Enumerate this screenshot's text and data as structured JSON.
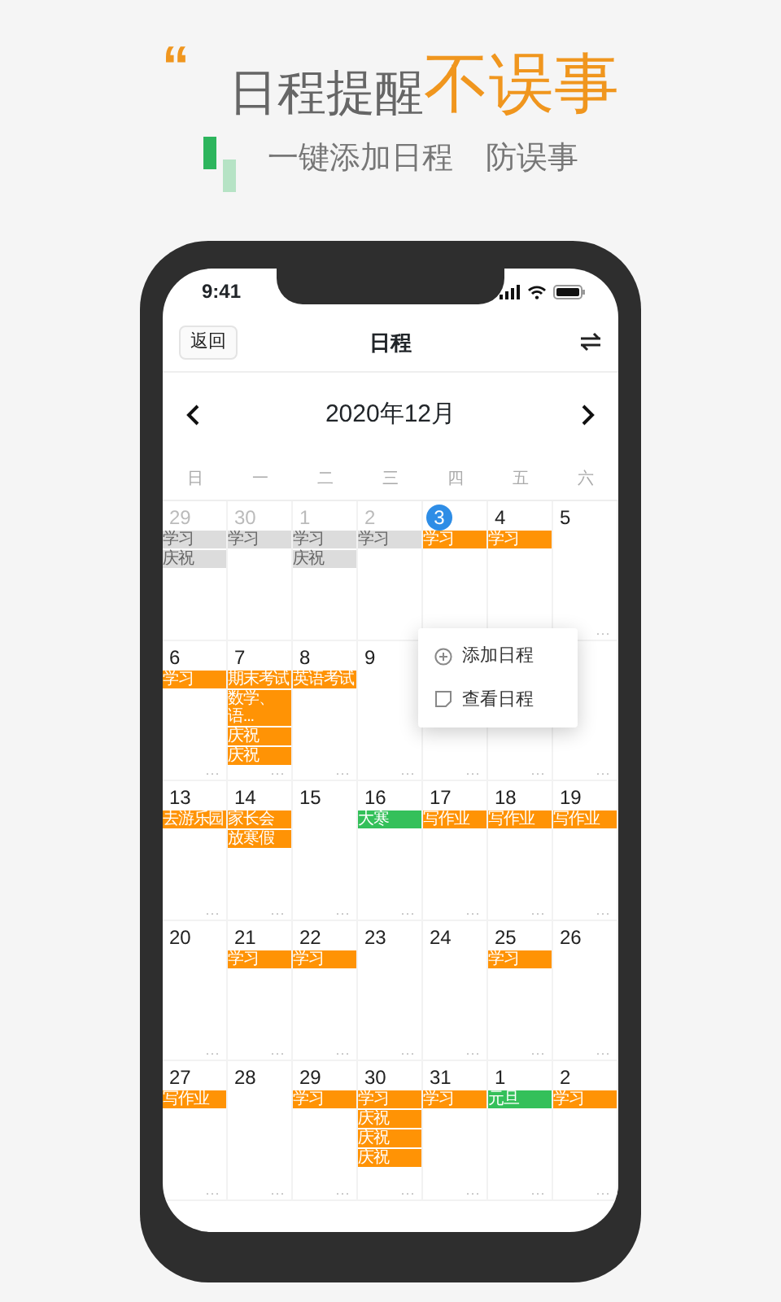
{
  "headline": {
    "quote": "“",
    "text": "日程提醒",
    "emphasis": "不误事"
  },
  "subtitle": [
    "一键添加日程",
    "防误事"
  ],
  "app": {
    "time": "9:41",
    "back": "返回",
    "title": "日程",
    "month": "2020年12月",
    "weekdays": [
      "日",
      "一",
      "二",
      "三",
      "四",
      "五",
      "六"
    ],
    "weeks": [
      [
        {
          "day": "29",
          "other_month": true,
          "today": false,
          "events": [
            {
              "text": "学习",
              "color": "#dcdcdc"
            },
            {
              "text": "庆祝",
              "color": "#dcdcdc"
            }
          ]
        },
        {
          "day": "30",
          "other_month": true,
          "today": false,
          "events": [
            {
              "text": "学习",
              "color": "#dcdcdc"
            }
          ]
        },
        {
          "day": "1",
          "other_month": true,
          "today": false,
          "events": [
            {
              "text": "学习",
              "color": "#dcdcdc"
            },
            {
              "text": "庆祝",
              "color": "#dcdcdc"
            }
          ]
        },
        {
          "day": "2",
          "other_month": true,
          "today": false,
          "events": [
            {
              "text": "学习",
              "color": "#dcdcdc"
            }
          ]
        },
        {
          "day": "3",
          "other_month": false,
          "today": true,
          "events": [
            {
              "text": "学习",
              "color": "#ff9305"
            }
          ]
        },
        {
          "day": "4",
          "other_month": false,
          "today": false,
          "events": [
            {
              "text": "学习",
              "color": "#ff9305"
            }
          ]
        },
        {
          "day": "5",
          "other_month": false,
          "today": false,
          "more": "···"
        }
      ],
      [
        {
          "day": "6",
          "other_month": false,
          "today": false,
          "events": [
            {
              "text": "学习",
              "color": "#ff9305"
            }
          ],
          "more": "···"
        },
        {
          "day": "7",
          "other_month": false,
          "today": false,
          "events": [
            {
              "text": "期末考试",
              "color": "#ff9305"
            },
            {
              "text": "数学、语...",
              "color": "#ff9305"
            },
            {
              "text": "庆祝",
              "color": "#ff9305"
            },
            {
              "text": "庆祝",
              "color": "#ff9305"
            }
          ],
          "more": "···"
        },
        {
          "day": "8",
          "other_month": false,
          "today": false,
          "events": [
            {
              "text": "英语考试",
              "color": "#ff9305"
            }
          ],
          "more": "···"
        },
        {
          "day": "9",
          "other_month": false,
          "today": false,
          "more": "···"
        },
        {
          "more": "···"
        },
        {
          "more": "···"
        },
        {
          "more": "···"
        }
      ],
      [
        {
          "day": "13",
          "other_month": false,
          "today": false,
          "events": [
            {
              "text": "去游乐园",
              "color": "#ff9305"
            }
          ],
          "more": "···"
        },
        {
          "day": "14",
          "other_month": false,
          "today": false,
          "events": [
            {
              "text": "家长会",
              "color": "#ff9305"
            },
            {
              "text": "放寒假",
              "color": "#ff9305"
            }
          ],
          "more": "···"
        },
        {
          "day": "15",
          "other_month": false,
          "today": false,
          "more": "···"
        },
        {
          "day": "16",
          "other_month": false,
          "today": false,
          "events": [
            {
              "text": "大寒",
              "color": "#34c05a"
            }
          ],
          "more": "···"
        },
        {
          "day": "17",
          "other_month": false,
          "today": false,
          "events": [
            {
              "text": "写作业",
              "color": "#ff9305"
            }
          ],
          "more": "···"
        },
        {
          "day": "18",
          "other_month": false,
          "today": false,
          "events": [
            {
              "text": "写作业",
              "color": "#ff9305"
            }
          ],
          "more": "···"
        },
        {
          "day": "19",
          "other_month": false,
          "today": false,
          "events": [
            {
              "text": "写作业",
              "color": "#ff9305"
            }
          ],
          "more": "···"
        }
      ],
      [
        {
          "day": "20",
          "other_month": false,
          "today": false,
          "more": "···"
        },
        {
          "day": "21",
          "other_month": false,
          "today": false,
          "events": [
            {
              "text": "学习",
              "color": "#ff9305"
            }
          ],
          "more": "···"
        },
        {
          "day": "22",
          "other_month": false,
          "today": false,
          "events": [
            {
              "text": "学习",
              "color": "#ff9305"
            }
          ],
          "more": "···"
        },
        {
          "day": "23",
          "other_month": false,
          "today": false,
          "more": "···"
        },
        {
          "day": "24",
          "other_month": false,
          "today": false,
          "more": "···"
        },
        {
          "day": "25",
          "other_month": false,
          "today": false,
          "events": [
            {
              "text": "学习",
              "color": "#ff9305"
            }
          ],
          "more": "···"
        },
        {
          "day": "26",
          "other_month": false,
          "today": false,
          "more": "···"
        }
      ],
      [
        {
          "day": "27",
          "other_month": false,
          "today": false,
          "events": [
            {
              "text": "写作业",
              "color": "#ff9305"
            }
          ],
          "more": "···"
        },
        {
          "day": "28",
          "other_month": false,
          "today": false,
          "more": "···"
        },
        {
          "day": "29",
          "other_month": false,
          "today": false,
          "events": [
            {
              "text": "学习",
              "color": "#ff9305"
            }
          ],
          "more": "···"
        },
        {
          "day": "30",
          "other_month": false,
          "today": false,
          "events": [
            {
              "text": "学习",
              "color": "#ff9305"
            },
            {
              "text": "庆祝",
              "color": "#ff9305"
            },
            {
              "text": "庆祝",
              "color": "#ff9305"
            },
            {
              "text": "庆祝",
              "color": "#ff9305"
            }
          ],
          "more": "···"
        },
        {
          "day": "31",
          "other_month": false,
          "today": false,
          "events": [
            {
              "text": "学习",
              "color": "#ff9305"
            }
          ],
          "more": "···"
        },
        {
          "day": "1",
          "other_month": false,
          "today": false,
          "events": [
            {
              "text": "元旦",
              "color": "#34c05a"
            }
          ],
          "more": "···"
        },
        {
          "day": "2",
          "other_month": false,
          "today": false,
          "events": [
            {
              "text": "学习",
              "color": "#ff9305"
            }
          ],
          "more": "···"
        }
      ]
    ],
    "popup": [
      {
        "kind": "add",
        "label": "添加日程"
      },
      {
        "kind": "view",
        "label": "查看日程"
      }
    ]
  }
}
